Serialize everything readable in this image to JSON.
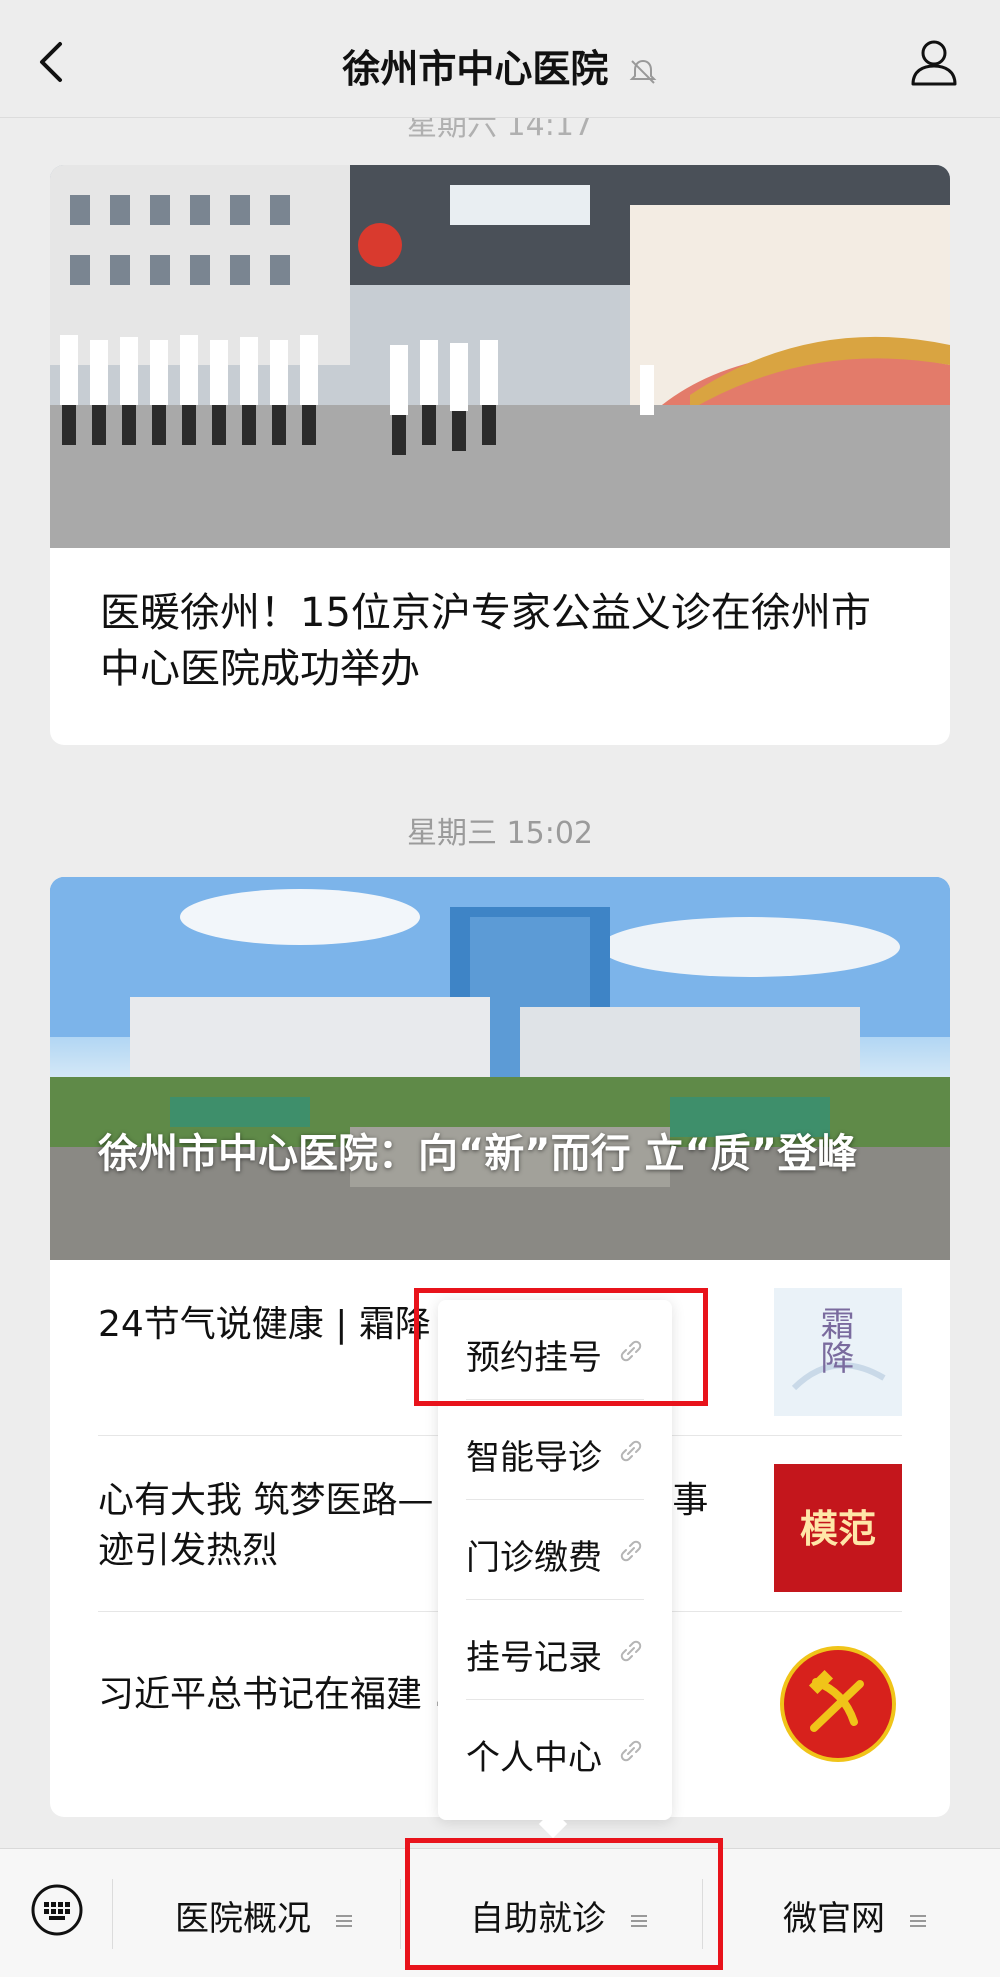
{
  "header": {
    "title": "徐州市中心医院",
    "back_icon": "chevron-left-icon",
    "mute_icon": "bell-off-icon",
    "profile_icon": "person-icon"
  },
  "feed": {
    "time_top": "星期六 14:17",
    "article1": {
      "title": "医暖徐州！15位京沪专家公益义诊在徐州市中心医院成功举办"
    },
    "time_mid": "星期三 15:02",
    "article2": {
      "cover_title": "徐州市中心医院：向“新”而行 立“质”登峰",
      "items": [
        {
          "title": "24节气说健康 | 霜降  ……  寒冬",
          "thumb_text": "霜降"
        },
        {
          "title": "心有大我 筑梦医路—  ……  生梅同志事迹引发热烈",
          "thumb_text": "模范"
        },
        {
          "title": "习近平总书记在福建  ……  实",
          "thumb_text": ""
        }
      ]
    }
  },
  "popup_menu": {
    "items": [
      {
        "label": "预约挂号",
        "icon": "link-icon"
      },
      {
        "label": "智能导诊",
        "icon": "link-icon"
      },
      {
        "label": "门诊缴费",
        "icon": "link-icon"
      },
      {
        "label": "挂号记录",
        "icon": "link-icon"
      },
      {
        "label": "个人中心",
        "icon": "link-icon"
      }
    ]
  },
  "bottom_menu": {
    "keyboard_icon": "keyboard-icon",
    "items": [
      {
        "label": "医院概况",
        "icon": "hamburger-icon"
      },
      {
        "label": "自助就诊",
        "icon": "hamburger-icon"
      },
      {
        "label": "微官网",
        "icon": "hamburger-icon"
      }
    ]
  },
  "colors": {
    "highlight": "#e8131b",
    "background": "#ededed"
  }
}
